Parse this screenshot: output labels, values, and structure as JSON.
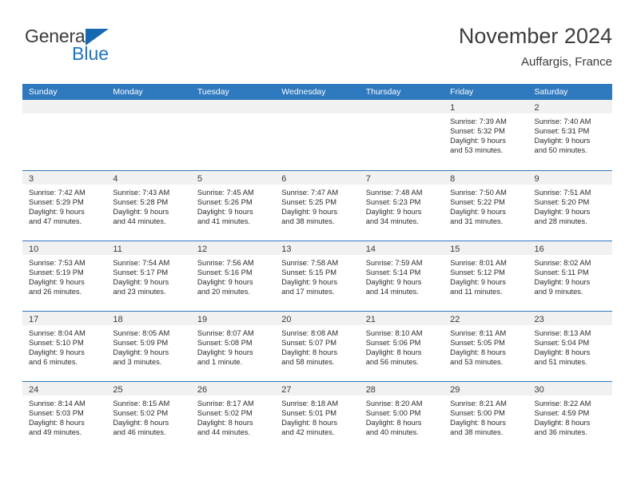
{
  "brand": {
    "name_top": "General",
    "name_bottom": "Blue",
    "flag_color": "#1668b3",
    "blue_color": "#1d74c0"
  },
  "header": {
    "title": "November 2024",
    "subtitle": "Auffargis, France"
  },
  "theme": {
    "header_bar": "#2f79bf",
    "day_band": "#f1f1f1",
    "text": "#2b2b2b"
  },
  "calendar": {
    "weekdays": [
      "Sunday",
      "Monday",
      "Tuesday",
      "Wednesday",
      "Thursday",
      "Friday",
      "Saturday"
    ],
    "weeks": [
      [
        {
          "day": "",
          "lines": []
        },
        {
          "day": "",
          "lines": []
        },
        {
          "day": "",
          "lines": []
        },
        {
          "day": "",
          "lines": []
        },
        {
          "day": "",
          "lines": []
        },
        {
          "day": "1",
          "lines": [
            "Sunrise: 7:39 AM",
            "Sunset: 5:32 PM",
            "Daylight: 9 hours",
            "and 53 minutes."
          ]
        },
        {
          "day": "2",
          "lines": [
            "Sunrise: 7:40 AM",
            "Sunset: 5:31 PM",
            "Daylight: 9 hours",
            "and 50 minutes."
          ]
        }
      ],
      [
        {
          "day": "3",
          "lines": [
            "Sunrise: 7:42 AM",
            "Sunset: 5:29 PM",
            "Daylight: 9 hours",
            "and 47 minutes."
          ]
        },
        {
          "day": "4",
          "lines": [
            "Sunrise: 7:43 AM",
            "Sunset: 5:28 PM",
            "Daylight: 9 hours",
            "and 44 minutes."
          ]
        },
        {
          "day": "5",
          "lines": [
            "Sunrise: 7:45 AM",
            "Sunset: 5:26 PM",
            "Daylight: 9 hours",
            "and 41 minutes."
          ]
        },
        {
          "day": "6",
          "lines": [
            "Sunrise: 7:47 AM",
            "Sunset: 5:25 PM",
            "Daylight: 9 hours",
            "and 38 minutes."
          ]
        },
        {
          "day": "7",
          "lines": [
            "Sunrise: 7:48 AM",
            "Sunset: 5:23 PM",
            "Daylight: 9 hours",
            "and 34 minutes."
          ]
        },
        {
          "day": "8",
          "lines": [
            "Sunrise: 7:50 AM",
            "Sunset: 5:22 PM",
            "Daylight: 9 hours",
            "and 31 minutes."
          ]
        },
        {
          "day": "9",
          "lines": [
            "Sunrise: 7:51 AM",
            "Sunset: 5:20 PM",
            "Daylight: 9 hours",
            "and 28 minutes."
          ]
        }
      ],
      [
        {
          "day": "10",
          "lines": [
            "Sunrise: 7:53 AM",
            "Sunset: 5:19 PM",
            "Daylight: 9 hours",
            "and 26 minutes."
          ]
        },
        {
          "day": "11",
          "lines": [
            "Sunrise: 7:54 AM",
            "Sunset: 5:17 PM",
            "Daylight: 9 hours",
            "and 23 minutes."
          ]
        },
        {
          "day": "12",
          "lines": [
            "Sunrise: 7:56 AM",
            "Sunset: 5:16 PM",
            "Daylight: 9 hours",
            "and 20 minutes."
          ]
        },
        {
          "day": "13",
          "lines": [
            "Sunrise: 7:58 AM",
            "Sunset: 5:15 PM",
            "Daylight: 9 hours",
            "and 17 minutes."
          ]
        },
        {
          "day": "14",
          "lines": [
            "Sunrise: 7:59 AM",
            "Sunset: 5:14 PM",
            "Daylight: 9 hours",
            "and 14 minutes."
          ]
        },
        {
          "day": "15",
          "lines": [
            "Sunrise: 8:01 AM",
            "Sunset: 5:12 PM",
            "Daylight: 9 hours",
            "and 11 minutes."
          ]
        },
        {
          "day": "16",
          "lines": [
            "Sunrise: 8:02 AM",
            "Sunset: 5:11 PM",
            "Daylight: 9 hours",
            "and 9 minutes."
          ]
        }
      ],
      [
        {
          "day": "17",
          "lines": [
            "Sunrise: 8:04 AM",
            "Sunset: 5:10 PM",
            "Daylight: 9 hours",
            "and 6 minutes."
          ]
        },
        {
          "day": "18",
          "lines": [
            "Sunrise: 8:05 AM",
            "Sunset: 5:09 PM",
            "Daylight: 9 hours",
            "and 3 minutes."
          ]
        },
        {
          "day": "19",
          "lines": [
            "Sunrise: 8:07 AM",
            "Sunset: 5:08 PM",
            "Daylight: 9 hours",
            "and 1 minute."
          ]
        },
        {
          "day": "20",
          "lines": [
            "Sunrise: 8:08 AM",
            "Sunset: 5:07 PM",
            "Daylight: 8 hours",
            "and 58 minutes."
          ]
        },
        {
          "day": "21",
          "lines": [
            "Sunrise: 8:10 AM",
            "Sunset: 5:06 PM",
            "Daylight: 8 hours",
            "and 56 minutes."
          ]
        },
        {
          "day": "22",
          "lines": [
            "Sunrise: 8:11 AM",
            "Sunset: 5:05 PM",
            "Daylight: 8 hours",
            "and 53 minutes."
          ]
        },
        {
          "day": "23",
          "lines": [
            "Sunrise: 8:13 AM",
            "Sunset: 5:04 PM",
            "Daylight: 8 hours",
            "and 51 minutes."
          ]
        }
      ],
      [
        {
          "day": "24",
          "lines": [
            "Sunrise: 8:14 AM",
            "Sunset: 5:03 PM",
            "Daylight: 8 hours",
            "and 49 minutes."
          ]
        },
        {
          "day": "25",
          "lines": [
            "Sunrise: 8:15 AM",
            "Sunset: 5:02 PM",
            "Daylight: 8 hours",
            "and 46 minutes."
          ]
        },
        {
          "day": "26",
          "lines": [
            "Sunrise: 8:17 AM",
            "Sunset: 5:02 PM",
            "Daylight: 8 hours",
            "and 44 minutes."
          ]
        },
        {
          "day": "27",
          "lines": [
            "Sunrise: 8:18 AM",
            "Sunset: 5:01 PM",
            "Daylight: 8 hours",
            "and 42 minutes."
          ]
        },
        {
          "day": "28",
          "lines": [
            "Sunrise: 8:20 AM",
            "Sunset: 5:00 PM",
            "Daylight: 8 hours",
            "and 40 minutes."
          ]
        },
        {
          "day": "29",
          "lines": [
            "Sunrise: 8:21 AM",
            "Sunset: 5:00 PM",
            "Daylight: 8 hours",
            "and 38 minutes."
          ]
        },
        {
          "day": "30",
          "lines": [
            "Sunrise: 8:22 AM",
            "Sunset: 4:59 PM",
            "Daylight: 8 hours",
            "and 36 minutes."
          ]
        }
      ]
    ]
  }
}
